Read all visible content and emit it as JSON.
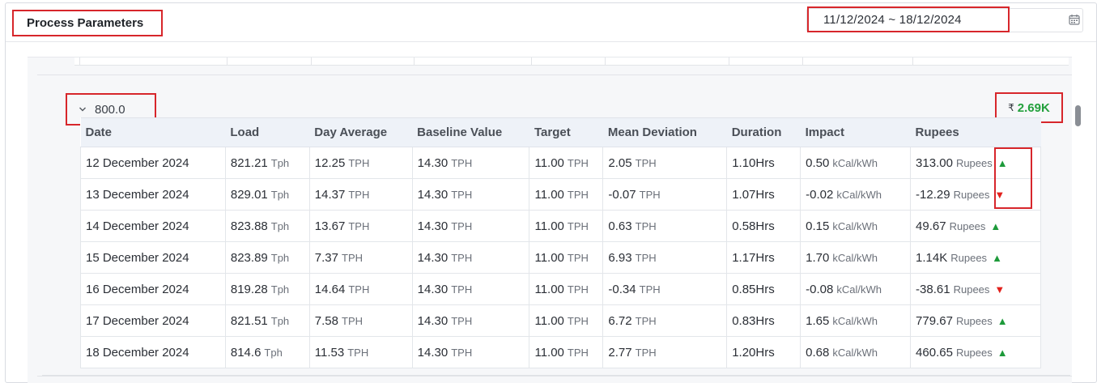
{
  "header": {
    "title": "Process Parameters",
    "date_range": "11/12/2024 ~ 18/12/2024"
  },
  "group": {
    "label": "800.0",
    "total_currency_symbol": "₹",
    "total_value": "2.69K"
  },
  "table": {
    "columns": [
      "Date",
      "Load",
      "Day Average",
      "Baseline Value",
      "Target",
      "Mean Deviation",
      "Duration",
      "Impact",
      "Rupees"
    ],
    "rows": [
      {
        "date": "12 December 2024",
        "load": "821.21",
        "load_unit": "Tph",
        "day_avg": "12.25",
        "day_avg_unit": "TPH",
        "baseline": "14.30",
        "baseline_unit": "TPH",
        "target": "11.00",
        "target_unit": "TPH",
        "mean_dev": "2.05",
        "mean_dev_unit": "TPH",
        "duration": "1.10Hrs",
        "impact": "0.50",
        "impact_unit": "kCal/kWh",
        "rupees": "313.00",
        "rupees_unit": "Rupees",
        "trend": "up"
      },
      {
        "date": "13 December 2024",
        "load": "829.01",
        "load_unit": "Tph",
        "day_avg": "14.37",
        "day_avg_unit": "TPH",
        "baseline": "14.30",
        "baseline_unit": "TPH",
        "target": "11.00",
        "target_unit": "TPH",
        "mean_dev": "-0.07",
        "mean_dev_unit": "TPH",
        "duration": "1.07Hrs",
        "impact": "-0.02",
        "impact_unit": "kCal/kWh",
        "rupees": "-12.29",
        "rupees_unit": "Rupees",
        "trend": "down"
      },
      {
        "date": "14 December 2024",
        "load": "823.88",
        "load_unit": "Tph",
        "day_avg": "13.67",
        "day_avg_unit": "TPH",
        "baseline": "14.30",
        "baseline_unit": "TPH",
        "target": "11.00",
        "target_unit": "TPH",
        "mean_dev": "0.63",
        "mean_dev_unit": "TPH",
        "duration": "0.58Hrs",
        "impact": "0.15",
        "impact_unit": "kCal/kWh",
        "rupees": "49.67",
        "rupees_unit": "Rupees",
        "trend": "up"
      },
      {
        "date": "15 December 2024",
        "load": "823.89",
        "load_unit": "Tph",
        "day_avg": "7.37",
        "day_avg_unit": "TPH",
        "baseline": "14.30",
        "baseline_unit": "TPH",
        "target": "11.00",
        "target_unit": "TPH",
        "mean_dev": "6.93",
        "mean_dev_unit": "TPH",
        "duration": "1.17Hrs",
        "impact": "1.70",
        "impact_unit": "kCal/kWh",
        "rupees": "1.14K",
        "rupees_unit": "Rupees",
        "trend": "up"
      },
      {
        "date": "16 December 2024",
        "load": "819.28",
        "load_unit": "Tph",
        "day_avg": "14.64",
        "day_avg_unit": "TPH",
        "baseline": "14.30",
        "baseline_unit": "TPH",
        "target": "11.00",
        "target_unit": "TPH",
        "mean_dev": "-0.34",
        "mean_dev_unit": "TPH",
        "duration": "0.85Hrs",
        "impact": "-0.08",
        "impact_unit": "kCal/kWh",
        "rupees": "-38.61",
        "rupees_unit": "Rupees",
        "trend": "down"
      },
      {
        "date": "17 December 2024",
        "load": "821.51",
        "load_unit": "Tph",
        "day_avg": "7.58",
        "day_avg_unit": "TPH",
        "baseline": "14.30",
        "baseline_unit": "TPH",
        "target": "11.00",
        "target_unit": "TPH",
        "mean_dev": "6.72",
        "mean_dev_unit": "TPH",
        "duration": "0.83Hrs",
        "impact": "1.65",
        "impact_unit": "kCal/kWh",
        "rupees": "779.67",
        "rupees_unit": "Rupees",
        "trend": "up"
      },
      {
        "date": "18 December 2024",
        "load": "814.6",
        "load_unit": "Tph",
        "day_avg": "11.53",
        "day_avg_unit": "TPH",
        "baseline": "14.30",
        "baseline_unit": "TPH",
        "target": "11.00",
        "target_unit": "TPH",
        "mean_dev": "2.77",
        "mean_dev_unit": "TPH",
        "duration": "1.20Hrs",
        "impact": "0.68",
        "impact_unit": "kCal/kWh",
        "rupees": "460.65",
        "rupees_unit": "Rupees",
        "trend": "up"
      }
    ]
  },
  "icons": {
    "expand": "chevron-down-icon",
    "calendar": "calendar-icon",
    "trend_up": "triangle-up-icon",
    "trend_down": "triangle-down-icon"
  },
  "colors": {
    "highlight_border": "#d7262b",
    "positive": "#1d9a3a",
    "negative": "#e2211c",
    "total_value": "#23a03c"
  }
}
